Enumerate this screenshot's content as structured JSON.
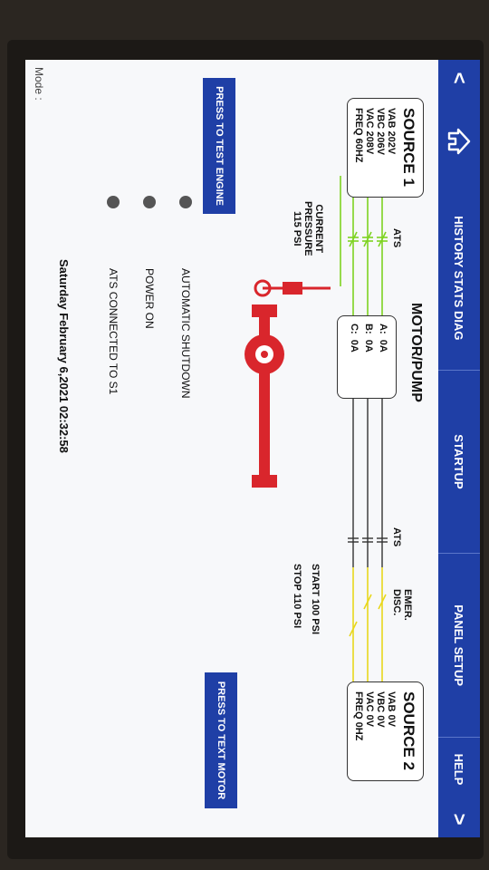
{
  "nav": {
    "back_glyph": "<",
    "forward_glyph": ">",
    "tabs": [
      "HISTORY STATS DIAG",
      "STARTUP",
      "PANEL SETUP",
      "HELP"
    ]
  },
  "source1": {
    "title": "SOURCE 1",
    "lines": [
      "VAB 202V",
      "VBC 206V",
      "VAC 208V",
      "FREQ 60HZ"
    ]
  },
  "source2": {
    "title": "SOURCE 2",
    "lines": [
      "VAB 0V",
      "VBC 0V",
      "VAC 0V",
      "FREQ 0HZ"
    ]
  },
  "ats_left_label": "ATS",
  "ats_right_label": "ATS",
  "emer_disc_label": [
    "EMER.",
    "DISC."
  ],
  "motor_pump_title": "MOTOR/PUMP",
  "amps": [
    {
      "phase": "A:",
      "value": "0A"
    },
    {
      "phase": "B:",
      "value": "0A"
    },
    {
      "phase": "C:",
      "value": "0A"
    }
  ],
  "current_pressure": [
    "CURRENT",
    "PRESSURE",
    "115 PSI"
  ],
  "start_pressure": "START  100 PSI",
  "stop_pressure": "STOP    110 PSI",
  "buttons": {
    "test_engine": "PRESS TO TEST ENGINE",
    "test_motor": "PRESS TO TEXT MOTOR"
  },
  "status_items": [
    "AUTOMATIC SHUTDOWN",
    "POWER ON",
    "ATS CONNECTED TO S1"
  ],
  "datetime": "Saturday February 6,2021 02:32:58",
  "mode_label": "Mode :",
  "colors": {
    "nav_blue": "#1f3fa6",
    "source1_line": "#7ed321",
    "source2_line": "#e8d71c",
    "pump_red": "#d9262c"
  }
}
